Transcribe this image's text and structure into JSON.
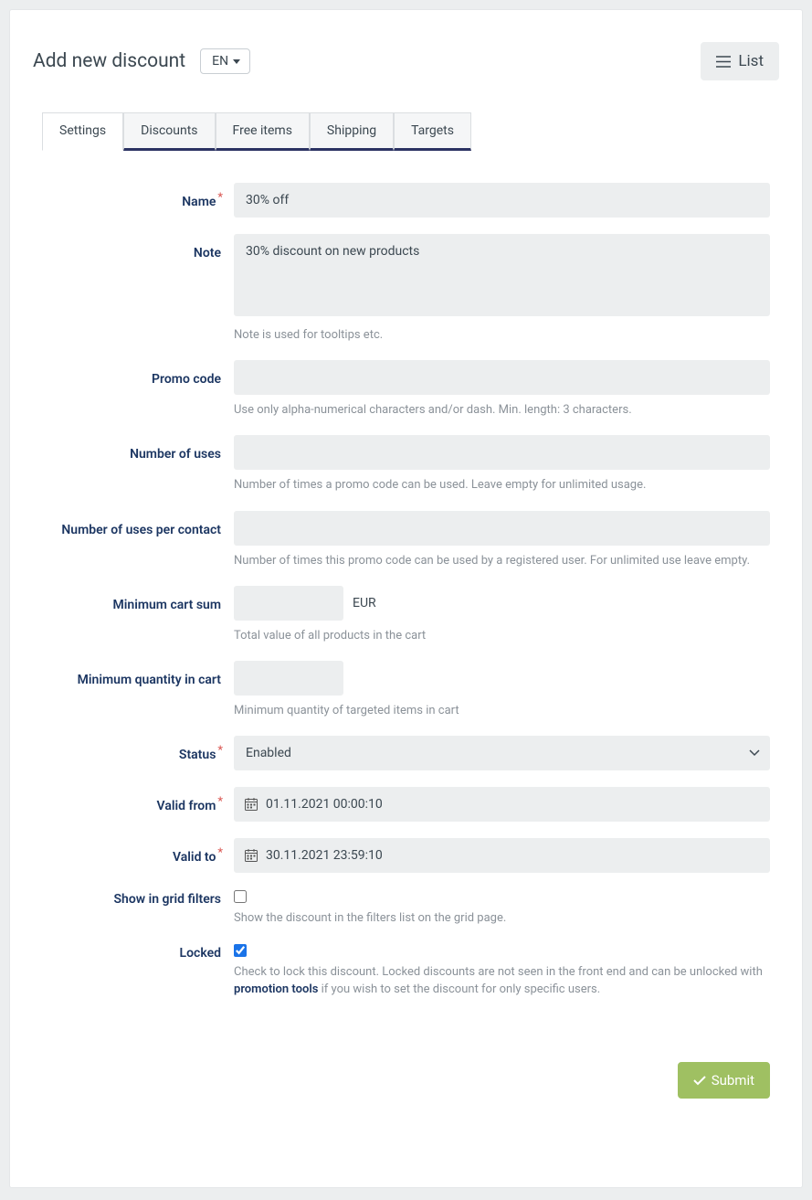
{
  "header": {
    "title": "Add new discount",
    "lang_label": "EN",
    "list_button": "List"
  },
  "tabs": {
    "settings": "Settings",
    "discounts": "Discounts",
    "free_items": "Free items",
    "shipping": "Shipping",
    "targets": "Targets"
  },
  "form": {
    "name": {
      "label": "Name",
      "value": "30% off"
    },
    "note": {
      "label": "Note",
      "value": "30% discount on new products",
      "help": "Note is used for tooltips etc."
    },
    "promo": {
      "label": "Promo code",
      "value": "",
      "help": "Use only alpha-numerical characters and/or dash. Min. length: 3 characters."
    },
    "uses": {
      "label": "Number of uses",
      "value": "",
      "help": "Number of times a promo code can be used. Leave empty for unlimited usage."
    },
    "uses_contact": {
      "label": "Number of uses per contact",
      "value": "",
      "help": "Number of times this promo code can be used by a registered user. For unlimited use leave empty."
    },
    "min_sum": {
      "label": "Minimum cart sum",
      "value": "",
      "currency": "EUR",
      "help": "Total value of all products in the cart"
    },
    "min_qty": {
      "label": "Minimum quantity in cart",
      "value": "",
      "help": "Minimum quantity of targeted items in cart"
    },
    "status": {
      "label": "Status",
      "selected": "Enabled"
    },
    "valid_from": {
      "label": "Valid from",
      "value": "01.11.2021 00:00:10"
    },
    "valid_to": {
      "label": "Valid to",
      "value": "30.11.2021 23:59:10"
    },
    "show_grid": {
      "label": "Show in grid filters",
      "help": "Show the discount in the filters list on the grid page."
    },
    "locked": {
      "label": "Locked",
      "help_pre": "Check to lock this discount. Locked discounts are not seen in the front end and can be unlocked with ",
      "help_link": "promotion tools",
      "help_post": " if you wish to set the discount for only specific users."
    }
  },
  "footer": {
    "submit": "Submit"
  }
}
